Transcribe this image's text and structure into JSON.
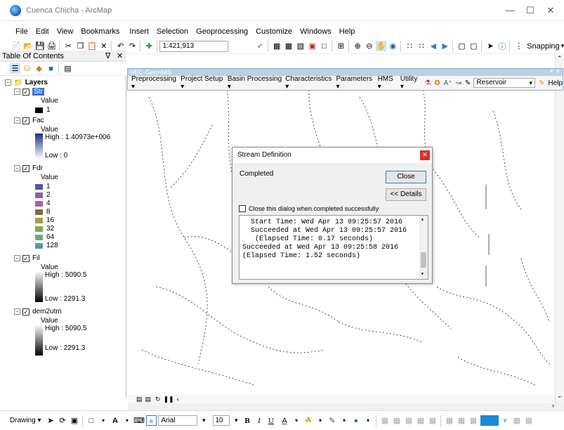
{
  "window": {
    "title": "Cuenca Chicha - ArcMap"
  },
  "menubar": {
    "items": [
      "File",
      "Edit",
      "View",
      "Bookmarks",
      "Insert",
      "Selection",
      "Geoprocessing",
      "Customize",
      "Windows",
      "Help"
    ]
  },
  "toolbar": {
    "scale": "1:421,913",
    "snapping_label": "Snapping"
  },
  "toc": {
    "title": "Table Of Contents",
    "root_label": "Layers",
    "layers": [
      {
        "name": "Str",
        "value_label": "Value",
        "classes": [
          "1"
        ]
      },
      {
        "name": "Fac",
        "value_label": "Value",
        "high": "High : 1.40973e+006",
        "low": "Low : 0"
      },
      {
        "name": "Fdr",
        "value_label": "Value",
        "classes": [
          "1",
          "2",
          "4",
          "8",
          "16",
          "32",
          "64",
          "128"
        ]
      },
      {
        "name": "Fil",
        "value_label": "Value",
        "high": "High : 5090.5",
        "low": "Low : 2291.3"
      },
      {
        "name": "dem2utm",
        "value_label": "Value",
        "high": "High : 5090.5",
        "low": "Low : 2291.3"
      }
    ],
    "fdr_colors": [
      "#4d59a6",
      "#8c5fa8",
      "#a85ea1",
      "#7a6f3e",
      "#a59c4f",
      "#7fa84d",
      "#6ea888",
      "#5d9b98"
    ]
  },
  "hms": {
    "title": "HEC-GeoHMS",
    "menus": [
      "Preprocessing",
      "Project Setup",
      "Basin Processing",
      "Characteristics",
      "Parameters",
      "HMS",
      "Utility"
    ],
    "reservoir": "Reservoir",
    "help": "Help"
  },
  "dialog": {
    "title": "Stream Definition",
    "status": "Completed",
    "close_button": "Close",
    "details_button": "<< Details",
    "checkbox_label": "Close this dialog when completed successfully",
    "log_lines": [
      "  Start Time: Wed Apr 13 09:25:57 2016",
      "  Succeeded at Wed Apr 13 09:25:57 2016",
      "   (Elapsed Time: 0.17 seconds)",
      "Succeeded at Wed Apr 13 09:25:58 2016",
      "(Elapsed Time: 1.52 seconds)"
    ]
  },
  "drawbar": {
    "drawing_label": "Drawing",
    "font": "Arial",
    "size": "10"
  }
}
